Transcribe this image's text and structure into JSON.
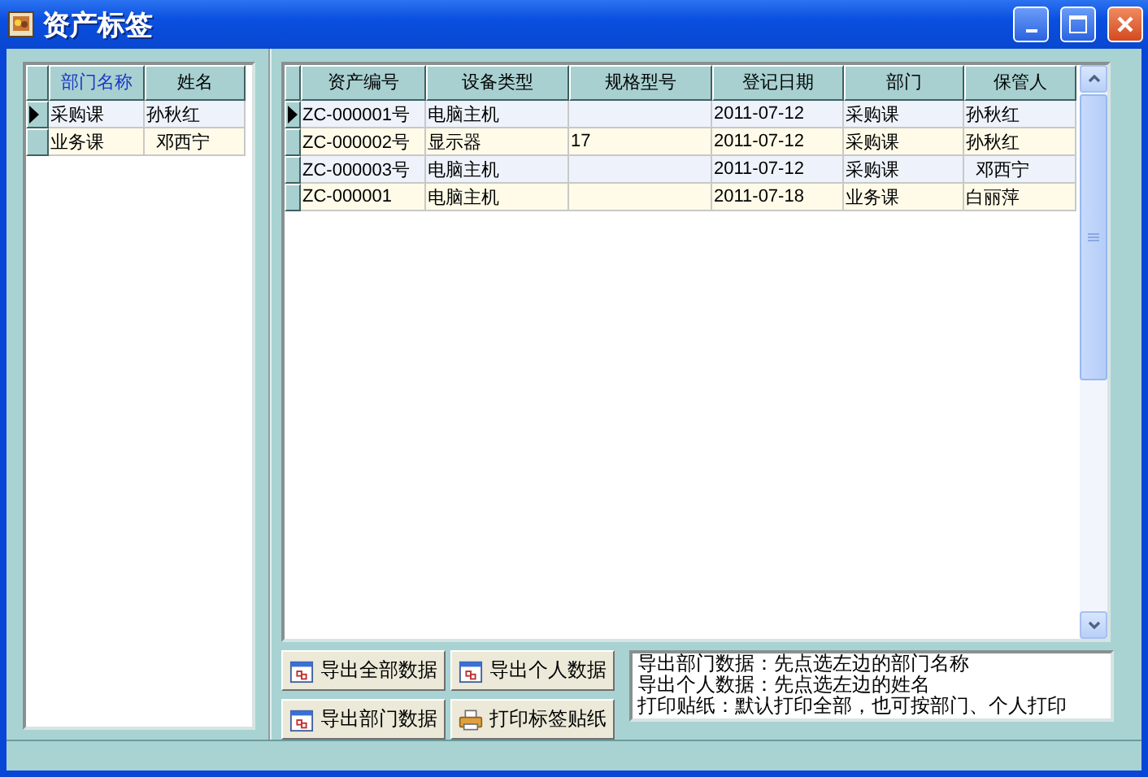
{
  "window": {
    "title": "资产标签"
  },
  "left_grid": {
    "columns": [
      {
        "label": "部门名称",
        "selected": true
      },
      {
        "label": "姓名",
        "selected": false
      }
    ],
    "rows": [
      {
        "cells": [
          "采购课",
          "孙秋红"
        ],
        "selected": true
      },
      {
        "cells": [
          "业务课",
          "  邓西宁"
        ],
        "selected": false
      }
    ]
  },
  "right_grid": {
    "columns": [
      {
        "label": "资产编号",
        "selected": false
      },
      {
        "label": "设备类型",
        "selected": false
      },
      {
        "label": "规格型号",
        "selected": false
      },
      {
        "label": "登记日期",
        "selected": false
      },
      {
        "label": "部门",
        "selected": false
      },
      {
        "label": "保管人",
        "selected": false
      }
    ],
    "rows": [
      {
        "cells": [
          "ZC-000001号",
          "电脑主机",
          "",
          "2011-07-12",
          "采购课",
          "孙秋红"
        ],
        "selected": true
      },
      {
        "cells": [
          "ZC-000002号",
          "显示器",
          "17",
          "2011-07-12",
          "采购课",
          "孙秋红"
        ],
        "selected": false
      },
      {
        "cells": [
          "ZC-000003号",
          "电脑主机",
          "",
          "2011-07-12",
          "采购课",
          "  邓西宁"
        ],
        "selected": false
      },
      {
        "cells": [
          "ZC-000001",
          "电脑主机",
          "",
          "2011-07-18",
          "业务课",
          "白丽萍"
        ],
        "selected": false
      }
    ]
  },
  "buttons": [
    {
      "label": "导出全部数据",
      "kind": "export"
    },
    {
      "label": "导出个人数据",
      "kind": "export"
    },
    {
      "label": "导出部门数据",
      "kind": "export"
    },
    {
      "label": "打印标签贴纸",
      "kind": "print"
    }
  ],
  "notes": [
    "导出部门数据：先点选左边的部门名称",
    "导出个人数据：先点选左边的姓名",
    "打印贴纸：默认打印全部，也可按部门、个人打印"
  ]
}
